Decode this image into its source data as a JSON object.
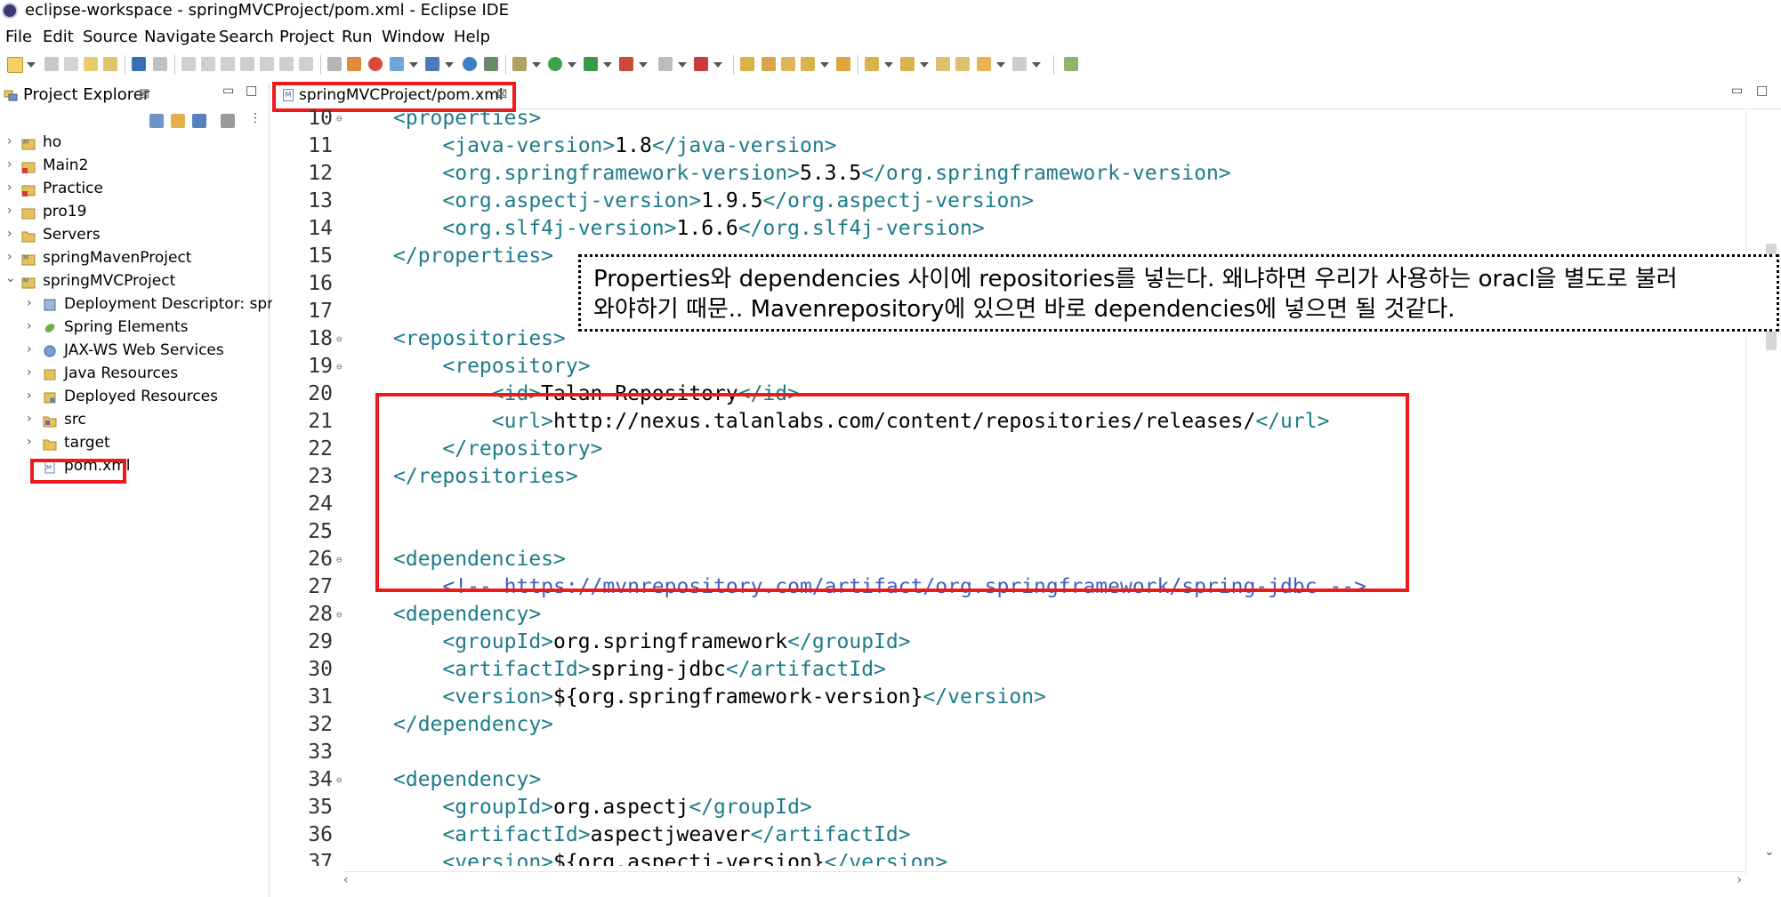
{
  "window": {
    "title": "eclipse-workspace - springMVCProject/pom.xml - Eclipse IDE"
  },
  "menu": [
    "File",
    "Edit",
    "Source",
    "Navigate",
    "Search",
    "Project",
    "Run",
    "Window",
    "Help"
  ],
  "explorer": {
    "tab_label": "Project Explorer",
    "close_glyph": "⊠",
    "items": [
      {
        "label": "ho",
        "arrow": "›",
        "icon": "maven-project-icon"
      },
      {
        "label": "Main2",
        "arrow": "›",
        "icon": "java-project-error-icon"
      },
      {
        "label": "Practice",
        "arrow": "›",
        "icon": "java-project-error-icon"
      },
      {
        "label": "pro19",
        "arrow": "›",
        "icon": "java-project-icon"
      },
      {
        "label": "Servers",
        "arrow": "›",
        "icon": "folder-icon"
      },
      {
        "label": "springMavenProject",
        "arrow": "›",
        "icon": "maven-project-icon"
      },
      {
        "label": "springMVCProject",
        "arrow": "⌄",
        "icon": "maven-project-icon"
      },
      {
        "label": "Deployment Descriptor: spring",
        "arrow": "›",
        "icon": "deployment-descriptor-icon"
      },
      {
        "label": "Spring Elements",
        "arrow": "›",
        "icon": "spring-leaf-icon"
      },
      {
        "label": "JAX-WS Web Services",
        "arrow": "›",
        "icon": "web-services-icon"
      },
      {
        "label": "Java Resources",
        "arrow": "›",
        "icon": "java-resources-icon"
      },
      {
        "label": "Deployed Resources",
        "arrow": "›",
        "icon": "deployed-resources-icon"
      },
      {
        "label": "src",
        "arrow": "›",
        "icon": "source-folder-icon"
      },
      {
        "label": "target",
        "arrow": "›",
        "icon": "folder-icon"
      },
      {
        "label": "pom.xml",
        "arrow": "",
        "icon": "xml-file-icon"
      }
    ]
  },
  "editor": {
    "tab_label": "springMVCProject/pom.xml",
    "close_glyph": "⊠",
    "lines": [
      {
        "n": "10",
        "fold": "⊖",
        "indent": "",
        "parts": [
          [
            "tag",
            "<properties>"
          ]
        ]
      },
      {
        "n": "11",
        "fold": "",
        "indent": "    ",
        "parts": [
          [
            "tag",
            "<java-version>"
          ],
          [
            "txt",
            "1.8"
          ],
          [
            "tag",
            "</java-version>"
          ]
        ]
      },
      {
        "n": "12",
        "fold": "",
        "indent": "    ",
        "parts": [
          [
            "tag",
            "<org.springframework-version>"
          ],
          [
            "txt",
            "5.3.5"
          ],
          [
            "tag",
            "</org.springframework-version>"
          ]
        ]
      },
      {
        "n": "13",
        "fold": "",
        "indent": "    ",
        "parts": [
          [
            "tag",
            "<org.aspectj-version>"
          ],
          [
            "txt",
            "1.9.5"
          ],
          [
            "tag",
            "</org.aspectj-version>"
          ]
        ]
      },
      {
        "n": "14",
        "fold": "",
        "indent": "    ",
        "parts": [
          [
            "tag",
            "<org.slf4j-version>"
          ],
          [
            "txt",
            "1.6.6"
          ],
          [
            "tag",
            "</org.slf4j-version>"
          ]
        ]
      },
      {
        "n": "15",
        "fold": "",
        "indent": "",
        "parts": [
          [
            "tag",
            "</properties>"
          ]
        ]
      },
      {
        "n": "16",
        "fold": "",
        "indent": "",
        "parts": []
      },
      {
        "n": "17",
        "fold": "",
        "indent": "",
        "parts": []
      },
      {
        "n": "18",
        "fold": "⊖",
        "indent": "",
        "parts": [
          [
            "tag",
            "<repositories>"
          ]
        ]
      },
      {
        "n": "19",
        "fold": "⊖",
        "indent": "    ",
        "parts": [
          [
            "tag",
            "<repository>"
          ]
        ]
      },
      {
        "n": "20",
        "fold": "",
        "indent": "        ",
        "parts": [
          [
            "tag",
            "<id>"
          ],
          [
            "txt",
            "Talan Repository"
          ],
          [
            "tag",
            "</id>"
          ]
        ]
      },
      {
        "n": "21",
        "fold": "",
        "indent": "        ",
        "parts": [
          [
            "tag",
            "<url>"
          ],
          [
            "txt",
            "http://nexus.talanlabs.com/content/repositories/releases/"
          ],
          [
            "tag",
            "</url>"
          ]
        ]
      },
      {
        "n": "22",
        "fold": "",
        "indent": "    ",
        "parts": [
          [
            "tag",
            "</repository>"
          ]
        ]
      },
      {
        "n": "23",
        "fold": "",
        "indent": "",
        "parts": [
          [
            "tag",
            "</repositories>"
          ]
        ]
      },
      {
        "n": "24",
        "fold": "",
        "indent": "",
        "parts": []
      },
      {
        "n": "25",
        "fold": "",
        "indent": "",
        "parts": []
      },
      {
        "n": "26",
        "fold": "⊖",
        "indent": "",
        "parts": [
          [
            "tag",
            "<dependencies>"
          ]
        ]
      },
      {
        "n": "27",
        "fold": "",
        "indent": "    ",
        "parts": [
          [
            "cmt",
            "<!-- https://mvnrepository.com/artifact/org.springframework/spring-jdbc -->"
          ]
        ]
      },
      {
        "n": "28",
        "fold": "⊖",
        "indent": "",
        "parts": [
          [
            "tag",
            "<dependency>"
          ]
        ]
      },
      {
        "n": "29",
        "fold": "",
        "indent": "    ",
        "parts": [
          [
            "tag",
            "<groupId>"
          ],
          [
            "txt",
            "org.springframework"
          ],
          [
            "tag",
            "</groupId>"
          ]
        ]
      },
      {
        "n": "30",
        "fold": "",
        "indent": "    ",
        "parts": [
          [
            "tag",
            "<artifactId>"
          ],
          [
            "txt",
            "spring-jdbc"
          ],
          [
            "tag",
            "</artifactId>"
          ]
        ]
      },
      {
        "n": "31",
        "fold": "",
        "indent": "    ",
        "parts": [
          [
            "tag",
            "<version>"
          ],
          [
            "txt",
            "${org.springframework-version}"
          ],
          [
            "tag",
            "</version>"
          ]
        ]
      },
      {
        "n": "32",
        "fold": "",
        "indent": "",
        "parts": [
          [
            "tag",
            "</dependency>"
          ]
        ]
      },
      {
        "n": "33",
        "fold": "",
        "indent": "",
        "parts": []
      },
      {
        "n": "34",
        "fold": "⊖",
        "indent": "",
        "parts": [
          [
            "tag",
            "<dependency>"
          ]
        ]
      },
      {
        "n": "35",
        "fold": "",
        "indent": "    ",
        "parts": [
          [
            "tag",
            "<groupId>"
          ],
          [
            "txt",
            "org.aspectj"
          ],
          [
            "tag",
            "</groupId>"
          ]
        ]
      },
      {
        "n": "36",
        "fold": "",
        "indent": "    ",
        "parts": [
          [
            "tag",
            "<artifactId>"
          ],
          [
            "txt",
            "aspectjweaver"
          ],
          [
            "tag",
            "</artifactId>"
          ]
        ]
      },
      {
        "n": "37",
        "fold": "",
        "indent": "    ",
        "parts": [
          [
            "tag",
            "<version>"
          ],
          [
            "txt",
            "${org.aspectj-version}"
          ],
          [
            "tag",
            "</version>"
          ]
        ]
      }
    ]
  },
  "annotation": {
    "line1": "Properties와 dependencies 사이에 repositories를 넣는다. 왜냐하면 우리가 사용하는 oracl을 별도로 불러",
    "line2": "와야하기 때문.. Mavenrepository에 있으면 바로 dependencies에 넣으면 될 것같다."
  },
  "colors": {
    "highlight": "#ee1a1a",
    "tag": "#1d7b8a",
    "comment": "#3f5fbf"
  }
}
